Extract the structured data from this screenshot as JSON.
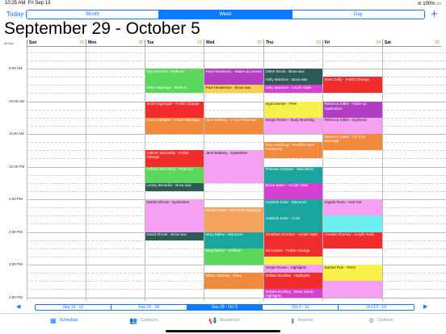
{
  "status": {
    "time": "10:25 AM",
    "date": "Fri Sep 13",
    "battery": "100%"
  },
  "toolbar": {
    "today_label": "Today",
    "segments": [
      "Month",
      "Week",
      "Day"
    ],
    "selected": "Week",
    "add_label": "+"
  },
  "page_title": "September 29 - October 5",
  "allday_label": "all day",
  "days": [
    {
      "name": "Sun",
      "num": "29"
    },
    {
      "name": "Mon",
      "num": "30"
    },
    {
      "name": "Tue",
      "num": "01"
    },
    {
      "name": "Wed",
      "num": "02"
    },
    {
      "name": "Thu",
      "num": "03"
    },
    {
      "name": "Fri",
      "num": "04"
    },
    {
      "name": "Sat",
      "num": "05"
    }
  ],
  "time_labels": [
    "9:00 AM",
    "10:00 AM",
    "11:00 AM",
    "12:00 PM",
    "1:00 PM",
    "2:00 PM",
    "3:00 PM",
    "4:00 PM"
  ],
  "events": [
    {
      "day": 2,
      "start": 9.0,
      "end": 9.5,
      "text": "Elly Harrison - Pedicure",
      "color": "#5bd75b"
    },
    {
      "day": 2,
      "start": 9.5,
      "end": 9.75,
      "text": "Holly Hagenige - Brow D.",
      "color": "#5bd75b"
    },
    {
      "day": 2,
      "start": 10.0,
      "end": 10.5,
      "text": "Scott Hagengeil - Polish Change",
      "color": "#f02c2c"
    },
    {
      "day": 2,
      "start": 10.5,
      "end": 11.0,
      "text": "Claire Haldane - 1 hour Massage",
      "color": "#f28a3e"
    },
    {
      "day": 2,
      "start": 11.5,
      "end": 12.0,
      "text": "Colleen McCarthy - Polish Change",
      "color": "#f02c2c"
    },
    {
      "day": 2,
      "start": 12.0,
      "end": 12.5,
      "text": "Colleen McCarthy - Pedicure",
      "color": "#5bd75b"
    },
    {
      "day": 2,
      "start": 12.5,
      "end": 12.75,
      "text": "Lesley Benedict - Brow wax",
      "color": "#2b5a57"
    },
    {
      "day": 2,
      "start": 13.0,
      "end": 14.0,
      "text": "Deidre Shrute - Eyelashes",
      "color": "#f5a0f0"
    },
    {
      "day": 2,
      "start": 14.0,
      "end": 14.25,
      "text": "David Shrute - Brow wax",
      "color": "#2b5a57"
    },
    {
      "day": 3,
      "start": 9.0,
      "end": 9.5,
      "text": "Paul Henderson - Make-up Lesson",
      "color": "#b03fc4"
    },
    {
      "day": 3,
      "start": 9.5,
      "end": 9.75,
      "text": "Paul Henderson - Brow wax",
      "color": "#f7d14a"
    },
    {
      "day": 3,
      "start": 10.5,
      "end": 11.0,
      "text": "Jane Bellamy - 1 hour Massage",
      "color": "#f28a3e"
    },
    {
      "day": 3,
      "start": 11.5,
      "end": 12.5,
      "text": "Jane Bellamy - Eyelashes",
      "color": "#f5a0f0"
    },
    {
      "day": 3,
      "start": 13.25,
      "end": 13.75,
      "text": "David Purkis - Hot Stone Massage",
      "color": "#f7a360"
    },
    {
      "day": 3,
      "start": 13.75,
      "end": 14.0,
      "text": "",
      "color": "#f7a360"
    },
    {
      "day": 3,
      "start": 14.0,
      "end": 14.5,
      "text": "Mary Bailey - Manicure",
      "color": "#1aa59e"
    },
    {
      "day": 3,
      "start": 14.5,
      "end": 15.0,
      "text": "Mary Bailey - Hellbare",
      "color": "#5bd75b"
    },
    {
      "day": 3,
      "start": 15.25,
      "end": 15.75,
      "text": "Milton Harshey - Perm",
      "color": "#f28a3e"
    },
    {
      "day": 4,
      "start": 9.0,
      "end": 9.25,
      "text": "Dieter Brock - Brow wax",
      "color": "#2b5a57"
    },
    {
      "day": 4,
      "start": 9.25,
      "end": 9.5,
      "text": "Holly Martines - Brow wax",
      "color": "#2b5a57"
    },
    {
      "day": 4,
      "start": 9.5,
      "end": 9.75,
      "text": "Holly Martines - Acrylic Nails",
      "color": "#d63fd0"
    },
    {
      "day": 4,
      "start": 10.0,
      "end": 10.5,
      "text": "Ingrid Winter - Peel",
      "color": "#f7f04a"
    },
    {
      "day": 4,
      "start": 10.5,
      "end": 11.0,
      "text": "Sergio Roses - Body Brushing",
      "color": "#f5a0f0"
    },
    {
      "day": 4,
      "start": 11.25,
      "end": 11.75,
      "text": "Max Headlong - Paraffin Hand Treatment",
      "color": "#f28a3e"
    },
    {
      "day": 4,
      "start": 12.0,
      "end": 12.5,
      "text": "Thomas Andrews - Wax Bikini",
      "color": "#1aa59e"
    },
    {
      "day": 4,
      "start": 12.5,
      "end": 13.0,
      "text": "Bruce Baker - Acrylic Nails",
      "color": "#d63fd0"
    },
    {
      "day": 4,
      "start": 13.0,
      "end": 13.5,
      "text": "Anabeth Koler - Manicure",
      "color": "#1aa59e"
    },
    {
      "day": 4,
      "start": 13.5,
      "end": 14.0,
      "text": "Anabeth Koler - Color",
      "color": "#1aa59e"
    },
    {
      "day": 4,
      "start": 14.0,
      "end": 14.5,
      "text": "Jonathan Sommer - Acrylic Nails",
      "color": "#f02c2c"
    },
    {
      "day": 4,
      "start": 14.5,
      "end": 14.75,
      "text": "Ed Connor - Polish Change",
      "color": "#f02c2c"
    },
    {
      "day": 4,
      "start": 14.75,
      "end": 15.0,
      "text": "",
      "color": "#f7f04a"
    },
    {
      "day": 4,
      "start": 15.0,
      "end": 15.25,
      "text": "Sergio Roses - Highlights",
      "color": "#f5a0f0"
    },
    {
      "day": 4,
      "start": 15.25,
      "end": 15.75,
      "text": "William Buckley - Highlights",
      "color": "#f02c2c"
    },
    {
      "day": 4,
      "start": 15.75,
      "end": 16.0,
      "text": "William Buckley - Brian David - Highlights",
      "color": "#d63fd0"
    },
    {
      "day": 5,
      "start": 9.25,
      "end": 9.75,
      "text": "Sean Duffy - Polish Change",
      "color": "#f02c2c"
    },
    {
      "day": 5,
      "start": 10.0,
      "end": 10.5,
      "text": "Rebecca Salter - Make-up Application",
      "color": "#b03fc4"
    },
    {
      "day": 5,
      "start": 10.5,
      "end": 11.0,
      "text": "Rebecca Salter - Eyebrow",
      "color": "#f5a0f0"
    },
    {
      "day": 5,
      "start": 11.0,
      "end": 11.5,
      "text": "Rebecca Salter - 1/2 hour Massage",
      "color": "#f28a3e"
    },
    {
      "day": 5,
      "start": 13.0,
      "end": 13.5,
      "text": "Angela Ross - Hair Cut",
      "color": "#f5a0f0"
    },
    {
      "day": 5,
      "start": 13.5,
      "end": 14.0,
      "text": "",
      "color": "#6cf0f0"
    },
    {
      "day": 5,
      "start": 14.0,
      "end": 14.5,
      "text": "Annette Sharkey - Acrylic Nails",
      "color": "#f02c2c"
    },
    {
      "day": 5,
      "start": 15.0,
      "end": 15.5,
      "text": "Rachel Fine - Perm",
      "color": "#f7f04a"
    },
    {
      "day": 5,
      "start": 15.5,
      "end": 16.0,
      "text": "",
      "color": "#f5a0f0"
    }
  ],
  "weeks": {
    "prev": "◀",
    "next": "▶",
    "items": [
      "Sep 15 - 21",
      "Sep 22 - 28",
      "Sep 29 - Oct 5",
      "Oct 6 - 12",
      "Oct 13 - 19"
    ],
    "selected": 2
  },
  "tabs": [
    {
      "label": "Schedule",
      "icon": "calendar-icon",
      "active": true
    },
    {
      "label": "Contacts",
      "icon": "contacts-icon",
      "active": false
    },
    {
      "label": "Broadcast",
      "icon": "megaphone-icon",
      "active": false
    },
    {
      "label": "Reports",
      "icon": "chart-icon",
      "active": false
    },
    {
      "label": "Options",
      "icon": "gear-icon",
      "active": false
    }
  ]
}
